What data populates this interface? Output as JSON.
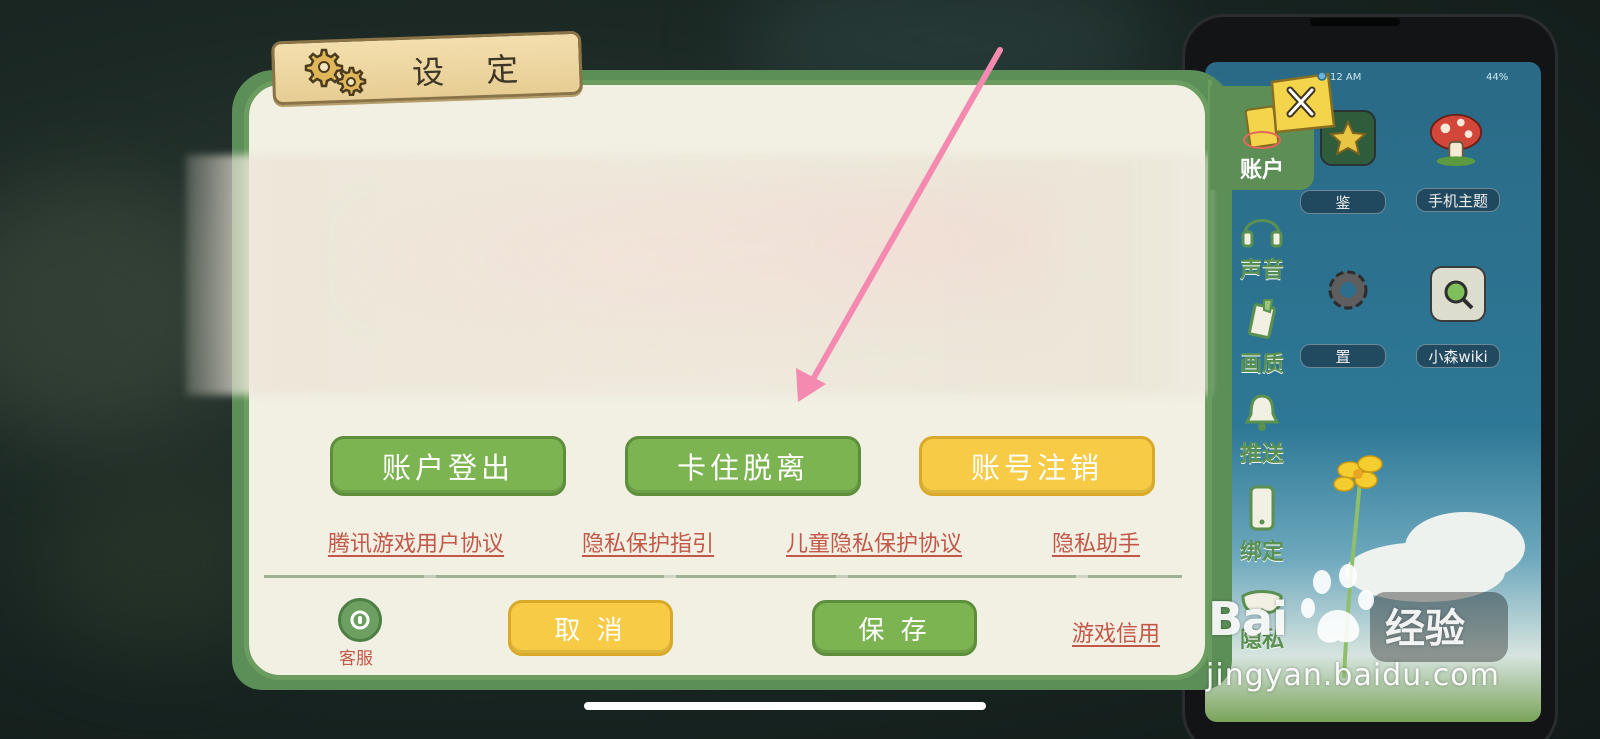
{
  "dialog": {
    "title": "设 定",
    "buttons": {
      "logout": "账户登出",
      "unstuck": "卡住脱离",
      "deregister": "账号注销"
    },
    "links": [
      "腾讯游戏用户协议",
      "隐私保护指引",
      "儿童隐私保护协议",
      "隐私助手"
    ],
    "footer": {
      "customer_service": "客服",
      "cancel": "取 消",
      "save": "保 存",
      "game_credit": "游戏信用"
    },
    "side_tabs": [
      {
        "label": "账户",
        "icon": "account-card-icon",
        "active": true
      },
      {
        "label": "声音",
        "icon": "headphones-icon",
        "active": false
      },
      {
        "label": "画质",
        "icon": "brush-icon",
        "active": false
      },
      {
        "label": "推送",
        "icon": "bell-icon",
        "active": false
      },
      {
        "label": "绑定",
        "icon": "phone-icon",
        "active": false
      },
      {
        "label": "隐私",
        "icon": "mask-icon",
        "active": false
      }
    ]
  },
  "phone": {
    "time": "12 AM",
    "battery": "44%",
    "apps": [
      {
        "label": "鉴",
        "icon": "star-book-icon"
      },
      {
        "label": "手机主题",
        "icon": "mushroom-icon"
      },
      {
        "label": "置",
        "icon": "gear-icon"
      },
      {
        "label": "小森wiki",
        "icon": "magnifier-icon"
      }
    ]
  },
  "watermark": {
    "brand": "Bai",
    "suffix": "经验",
    "url": "jingyan.baidu.com"
  },
  "colors": {
    "green": "#7cb452",
    "yellow": "#f7cb46",
    "link_red": "#c2584a",
    "frame_green": "#6a9d5f",
    "arrow_pink": "#f48ab0"
  }
}
